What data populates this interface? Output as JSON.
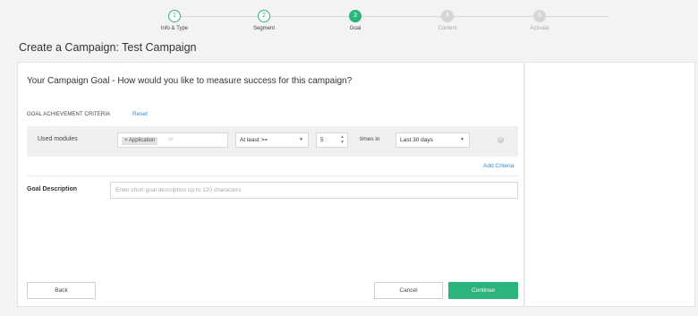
{
  "stepper": {
    "steps": [
      {
        "num": "1",
        "label": "Info & Type",
        "state": "done"
      },
      {
        "num": "2",
        "label": "Segment",
        "state": "done"
      },
      {
        "num": "3",
        "label": "Goal",
        "state": "active"
      },
      {
        "num": "4",
        "label": "Content",
        "state": "todo"
      },
      {
        "num": "5",
        "label": "Activate",
        "state": "todo"
      }
    ]
  },
  "page": {
    "title": "Create a Campaign: Test Campaign"
  },
  "goal": {
    "question": "Your Campaign Goal - How would you like to measure success for this campaign?",
    "criteria_heading": "GOAL ACHIEVEMENT CRITERIA",
    "reset_label": "Reset",
    "criteria": {
      "label": "Used modules",
      "tag": "Application",
      "tag_remove": "×",
      "or_text": "or",
      "operator": "At least >=",
      "count": "5",
      "times_in": "times in",
      "period": "Last 30 days"
    },
    "add_criteria_label": "Add Criteria",
    "description_label": "Goal Description",
    "description_placeholder": "Enter short goal description up to 120 characters"
  },
  "actions": {
    "back": "Back",
    "cancel": "Cancel",
    "continue": "Continue"
  },
  "colors": {
    "accent": "#2db37c",
    "link": "#2d8bd3"
  }
}
